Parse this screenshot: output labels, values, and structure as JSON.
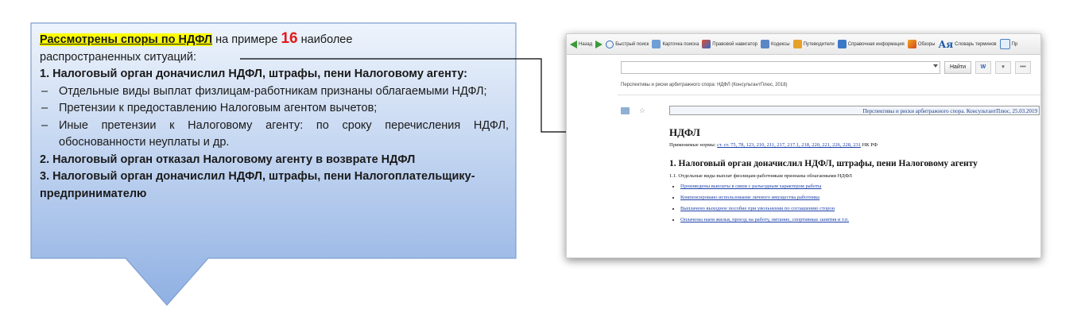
{
  "callout": {
    "highlight": "Рассмотрены споры по НДФЛ",
    "intro_mid": " на примере ",
    "count": "16",
    "intro_end": " наиболее",
    "intro_line2": "распространенных ситуаций:",
    "item1": "1. Налоговый орган доначислил НДФЛ, штрафы, пени Налоговому агенту:",
    "bullets": [
      "Отдельные виды выплат физлицам-работникам признаны облагаемыми НДФЛ;",
      "Претензии к предоставлению Налоговым агентом вычетов;",
      "Иные претензии к Налоговому агенту: по сроку перечисления НДФЛ, обоснованности неуплаты и др."
    ],
    "item2": "2. Налоговый орган отказал Налоговому агенту в возврате НДФЛ",
    "item3": "3. Налоговый орган доначислил НДФЛ, штрафы, пени Налогоплательщику-предпринимателю"
  },
  "app": {
    "toolbar": {
      "back": "Назад",
      "quick_search": "Быстрый поиск",
      "card_search": "Карточка поиска",
      "legal_navigator": "Правовой навигатор",
      "codes": "Кодексы",
      "guides": "Путеводители",
      "reference": "Справочная информация",
      "reviews": "Обзоры",
      "dictionary_glyph": "Ая",
      "dictionary": "Словарь терминов",
      "more": "Пр"
    },
    "search": {
      "find_label": "Найти",
      "more_label": "•••"
    },
    "breadcrumb": "Перспективы и риски арбитражного спора: НДФЛ (КонсультантПлюс, 2018)",
    "doc_bar_text": "Перспективы и риски арбитражного спора. КонсультантПлюс, 25.03.2019",
    "doc_title": "НДФЛ",
    "norms_label": "Применимые нормы: ",
    "norms_links": "ст. ст. 75, 78, 123, 210, 211, 217, 217.1, 218, 220, 221, 226, 228, 231",
    "norms_suffix": " НК РФ",
    "section_title": "1. Налоговый орган доначислил НДФЛ, штрафы, пени Налоговому агенту",
    "subsection": "1.1. Отдельные виды выплат физлицам-работникам признаны облагаемыми НДФЛ",
    "links": [
      "Произведены выплаты в связи с разъездным характером работы",
      "Компенсировано использование личного имущества работника",
      "Выплачено выходное пособие при увольнении по соглашению сторон",
      "Оплачены наем жилья, проезд на работу, питание, спортивные занятия и т.п."
    ]
  },
  "colors": {
    "callout_top": "#e8f0fb",
    "callout_bottom": "#8fb1e4",
    "callout_border": "#7f9fd0",
    "highlight": "#ffff00",
    "count": "#e11a1a",
    "link": "#1b3fa8"
  }
}
